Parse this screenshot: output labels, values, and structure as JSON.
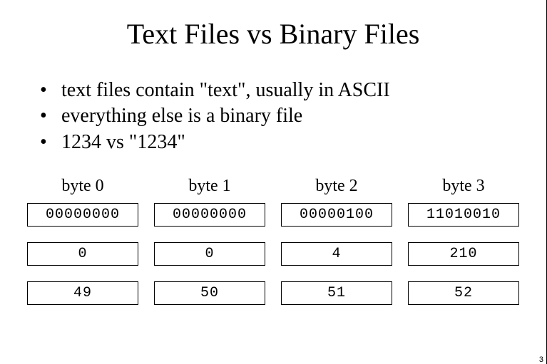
{
  "title": "Text Files vs Binary Files",
  "bullets": [
    "text files contain \"text\", usually in ASCII",
    "everything else is a binary file",
    "1234 vs \"1234\""
  ],
  "headers": [
    "byte 0",
    "byte 1",
    "byte 2",
    "byte 3"
  ],
  "rows": [
    [
      "00000000",
      "00000000",
      "00000100",
      "11010010"
    ],
    [
      "0",
      "0",
      "4",
      "210"
    ],
    [
      "49",
      "50",
      "51",
      "52"
    ]
  ],
  "corner": "3"
}
